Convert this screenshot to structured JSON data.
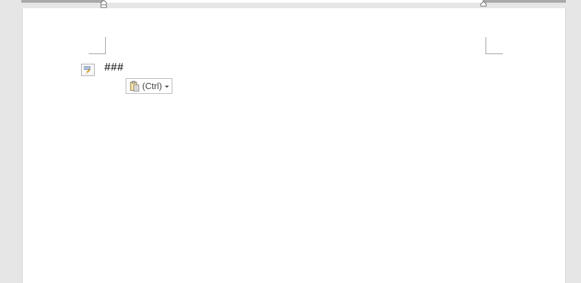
{
  "document": {
    "text": "###"
  },
  "paste_options": {
    "label": "(Ctrl)",
    "icon": "clipboard-paste-icon"
  },
  "autocorrect_options": {
    "icon": "autocorrect-lightning-icon"
  },
  "colors": {
    "workspace_bg": "#e6e6e6",
    "page_bg": "#ffffff",
    "ruler_inactive": "#a9a9a9",
    "ruler_active": "#ffffff",
    "paste_icon_yellow": "#f0c040"
  }
}
